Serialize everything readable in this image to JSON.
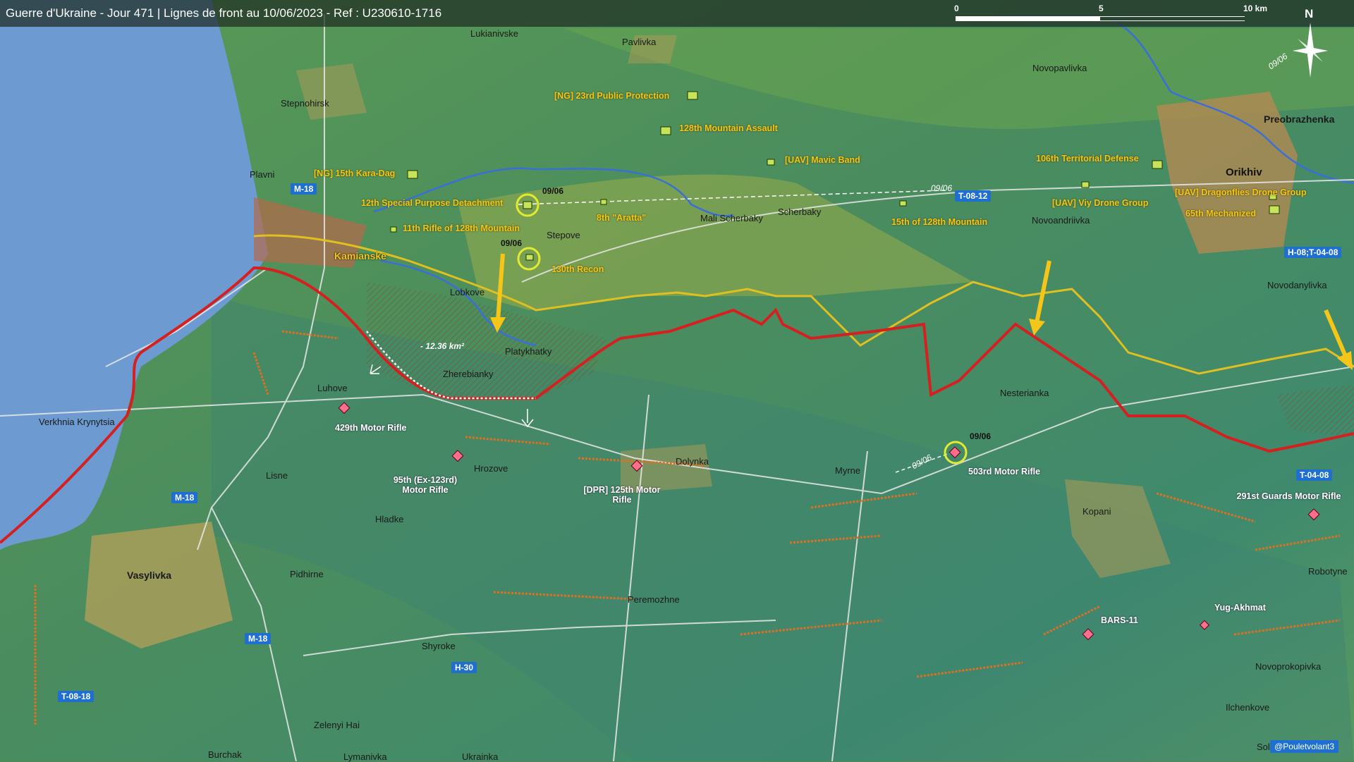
{
  "title": "Guerre d'Ukraine - Jour 471 | Lignes de front au 10/06/2023 - Ref : U230610-1716",
  "scale": {
    "labels": [
      "0",
      "5",
      "10 km"
    ]
  },
  "compass": {
    "label": "N"
  },
  "places": [
    "Lukianivske",
    "Pavlivka",
    "Stepnohirsk",
    "Plavni",
    "Kamianske",
    "Lobkove",
    "Platykhatky",
    "Zherebianky",
    "Luhove",
    "Verkhnia Krynytsia",
    "Lisne",
    "Hrozove",
    "Hladke",
    "Vasylivka",
    "Pidhirne",
    "Peremozhne",
    "Shyroke",
    "Zelenyi Hai",
    "Burchak",
    "Lymanivka",
    "Ukrainka",
    "Stepove",
    "Mali Scherbaky",
    "Scherbaky",
    "Dolynka",
    "Myrne",
    "Nesterianka",
    "Novopavlivka",
    "Preobrazhenka",
    "Orikhiv",
    "Novoandriivka",
    "Novodanylivka",
    "Kopani",
    "Robotyne",
    "Novoprokopivka",
    "Ilchenkove",
    "Sol"
  ],
  "ua_units": [
    "[NG] 23rd Public Protection",
    "128th Mountain Assault",
    "[NG] 15th Kara-Dag",
    "[UAV] Mavic Band",
    "12th Special Purpose Detachment",
    "8th \"Aratta\"",
    "11th Rifle of 128th Mountain",
    "130th Recon",
    "15th of 128th Mountain",
    "106th Territorial Defense",
    "[UAV] Viy Drone Group",
    "[UAV] Dragonflies Drone Group",
    "65th Mechanized"
  ],
  "ru_units": [
    "429th Motor Rifle",
    "95th (Ex-123rd) Motor Rifle",
    "[DPR] 125th Motor Rifle",
    "503rd Motor Rifle",
    "291st Guards Motor Rifle",
    "BARS-11",
    "Yug-Akhmat"
  ],
  "roads": [
    "M-18",
    "M-18",
    "M-18",
    "T-08-12",
    "H-08;T-04-08",
    "T-04-08",
    "H-30",
    "T-08-18"
  ],
  "dates": [
    "09/06",
    "09/06",
    "09/06",
    "09/06",
    "09/06",
    "09/06"
  ],
  "area_label": "- 12.36 km²",
  "credit": "@Pouletvolant3",
  "colors": {
    "frontline_ru": "#d62020",
    "frontline_ua": "#e0c020",
    "water": "#6d9bd1",
    "ua_unit": "#f5c518",
    "ru_unit": "#ff6f8a"
  }
}
